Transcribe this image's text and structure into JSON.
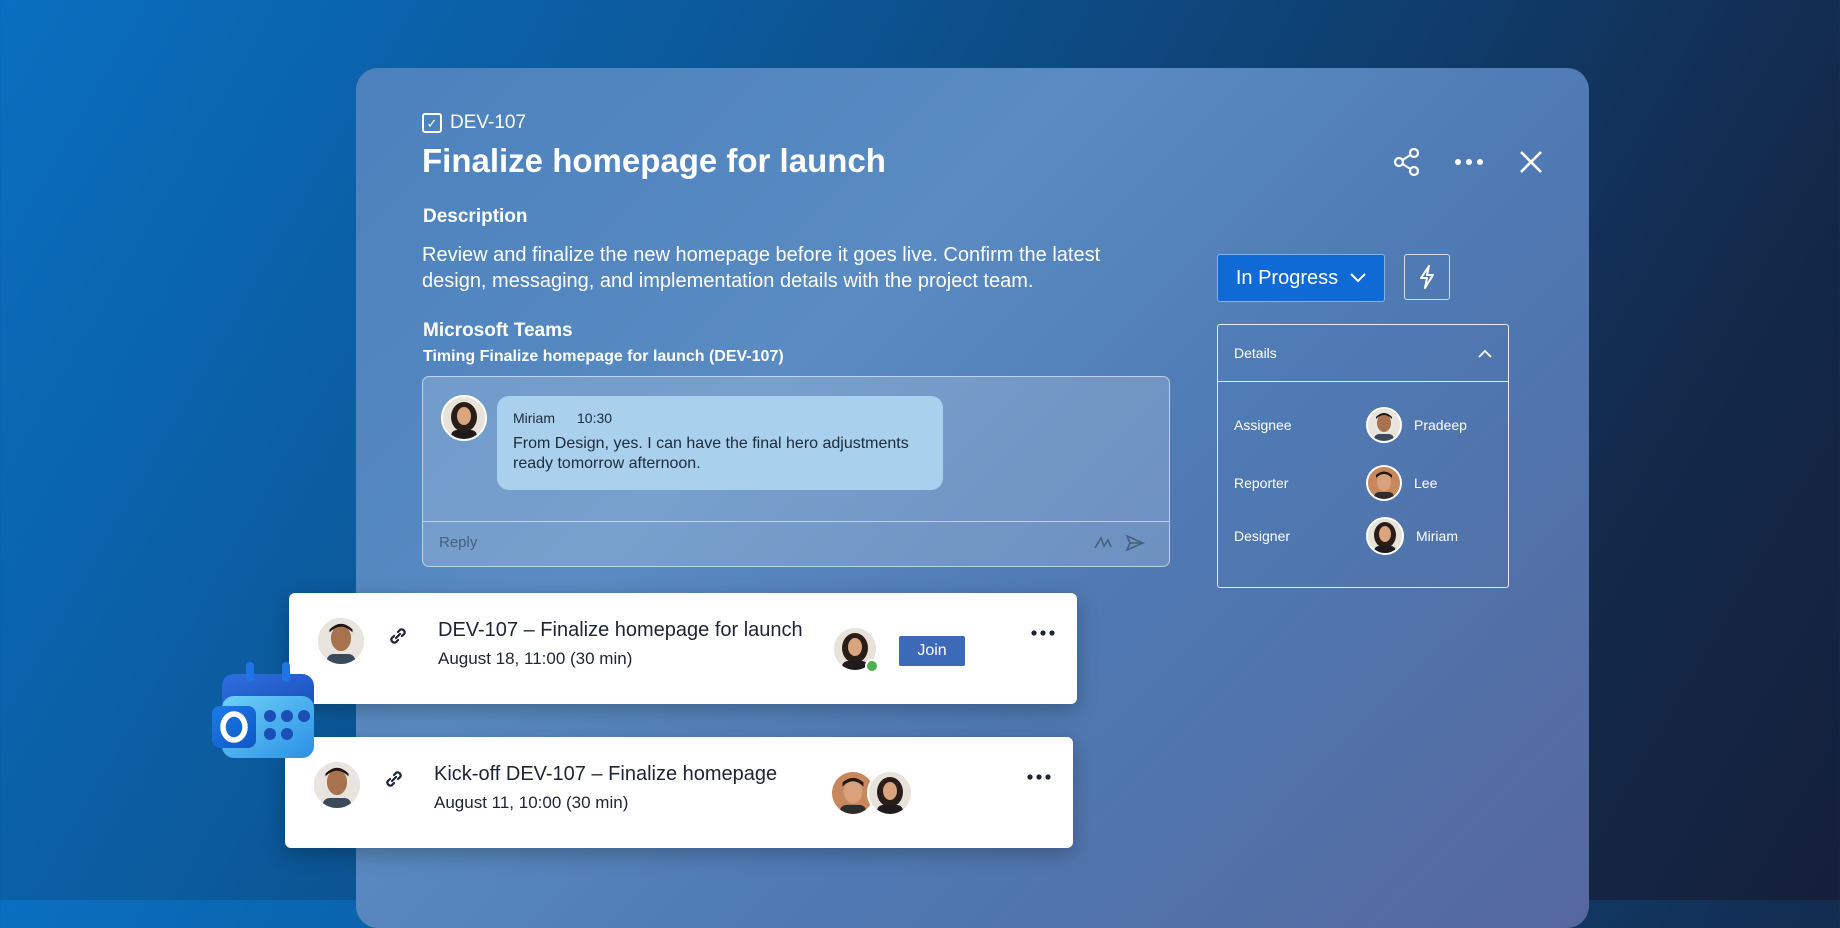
{
  "issue": {
    "key": "DEV-107",
    "title": "Finalize homepage for launch",
    "description_heading": "Description",
    "description": "Review and finalize the new homepage before it goes live. Confirm the latest design, messaging, and implementation details with the project team."
  },
  "teams": {
    "heading": "Microsoft Teams",
    "thread_title": "Timing Finalize homepage for launch (DEV-107)",
    "message": {
      "author": "Miriam",
      "time": "10:30",
      "text": "From Design, yes. I can have the final hero adjustments ready tomorrow afternoon."
    },
    "reply_placeholder": "Reply"
  },
  "status": {
    "label": "In Progress"
  },
  "details": {
    "heading": "Details",
    "rows": [
      {
        "label": "Assignee",
        "value": "Pradeep"
      },
      {
        "label": "Reporter",
        "value": "Lee"
      },
      {
        "label": "Designer",
        "value": "Miriam"
      }
    ]
  },
  "meetings": [
    {
      "title": "DEV-107 – Finalize homepage for launch",
      "time": "August 18, 11:00 (30 min)",
      "join_label": "Join"
    },
    {
      "title": "Kick-off DEV-107 – Finalize homepage",
      "time": "August 11, 10:00  (30 min)"
    }
  ],
  "colors": {
    "accent": "#0f6ad6",
    "join": "#3d6ab8",
    "bubble": "#a9d1ee",
    "presence": "#4caf50"
  },
  "icons": [
    "checkbox-icon",
    "share-icon",
    "more-icon",
    "close-icon",
    "chevron-down-icon",
    "bolt-icon",
    "chevron-up-icon",
    "link-icon",
    "send-icon",
    "loop-icon",
    "outlook-calendar-icon"
  ]
}
